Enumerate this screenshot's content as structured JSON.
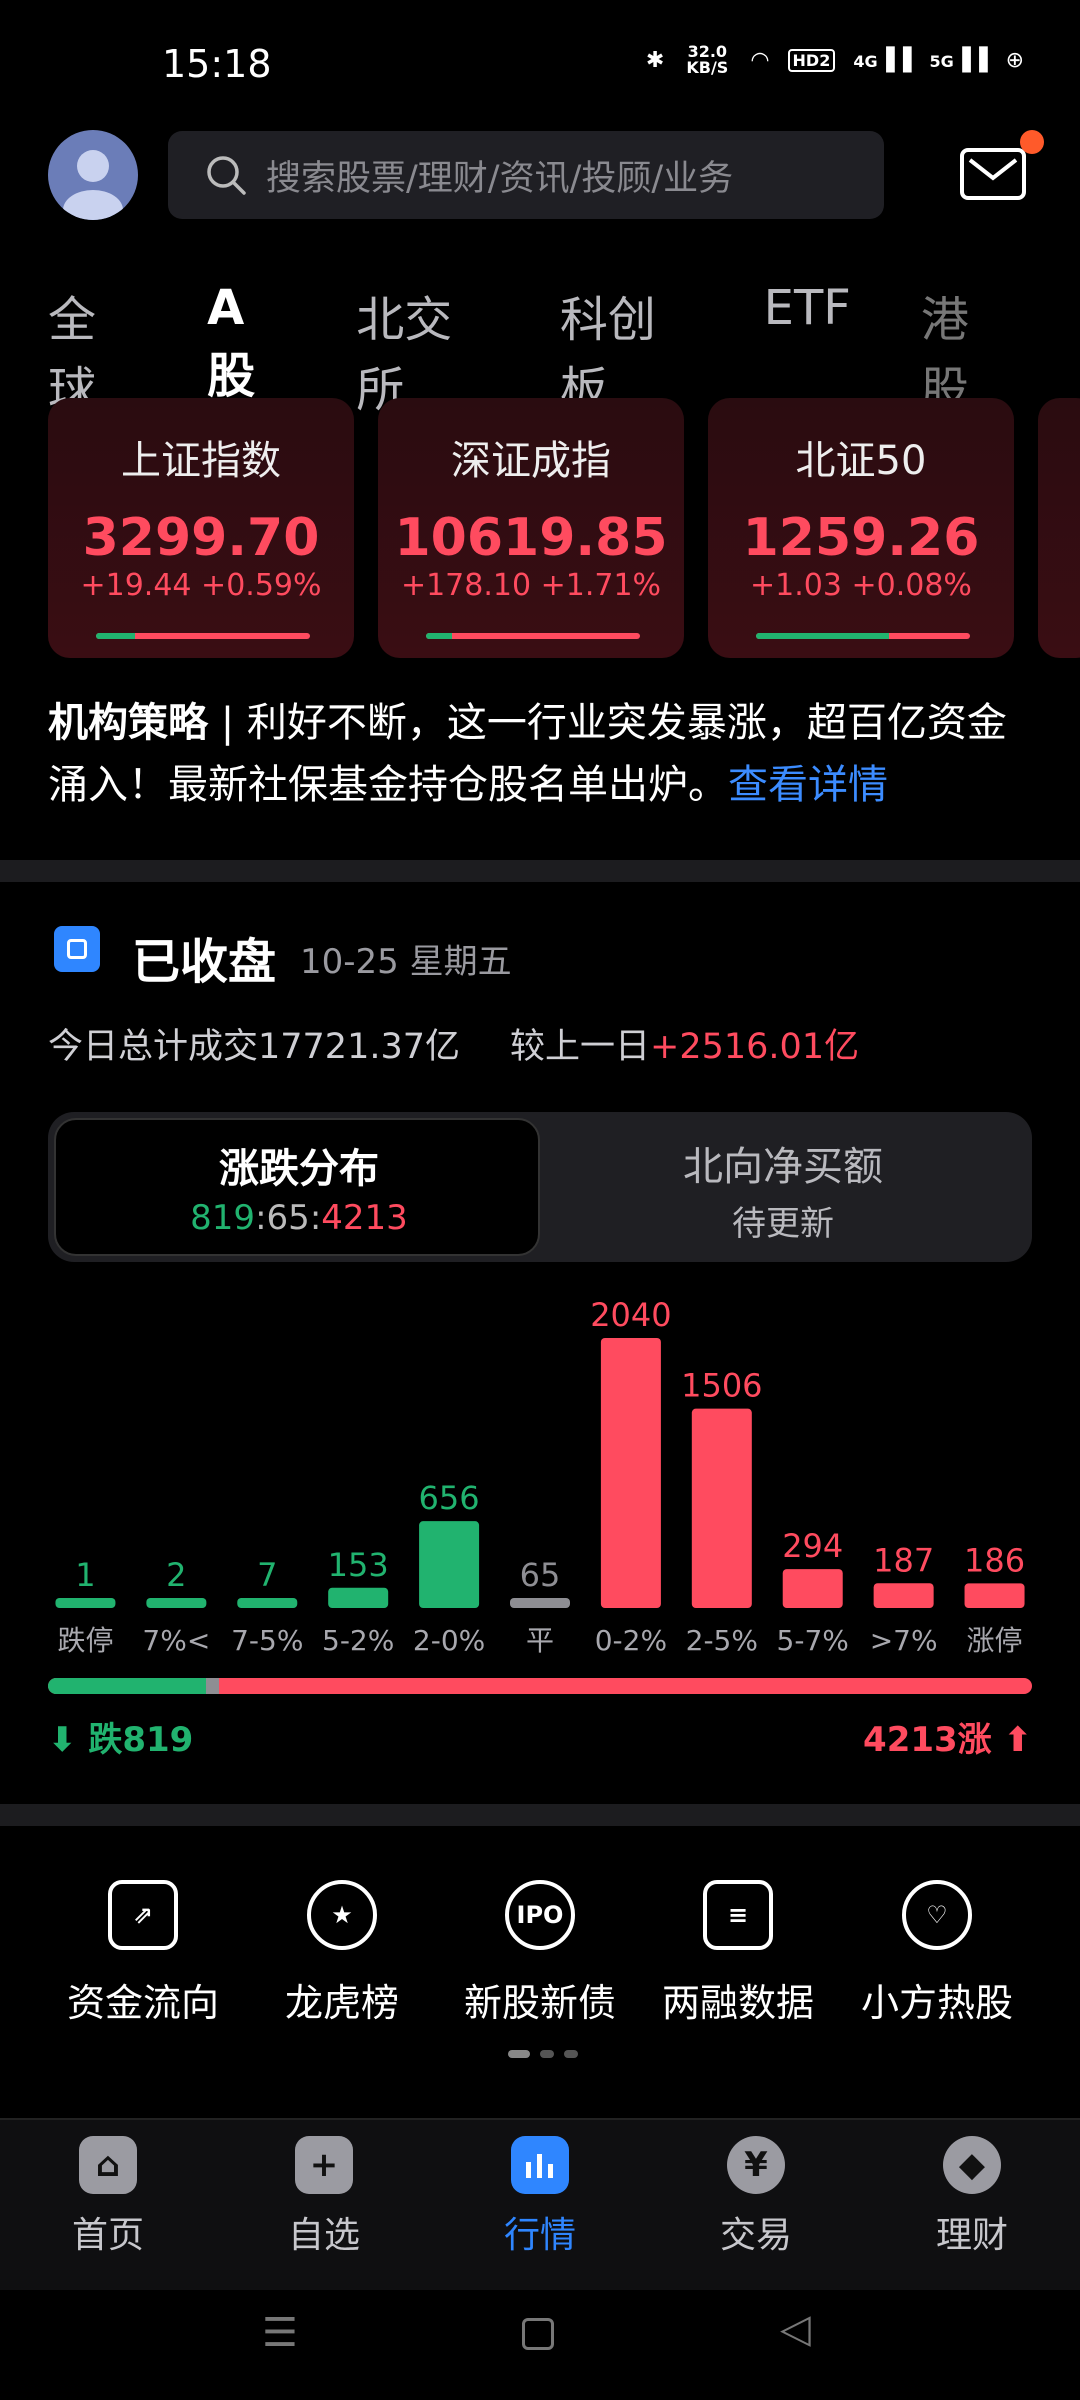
{
  "status": {
    "time": "15:18",
    "net_speed": "32.0 KB/S",
    "hd": "HD2",
    "sig1": "4G",
    "sig2": "5G"
  },
  "search": {
    "placeholder": "搜索股票/理财/资讯/投顾/业务"
  },
  "tabs": [
    "全球",
    "A股",
    "北交所",
    "科创板",
    "ETF",
    "港股"
  ],
  "active_tab": "A股",
  "indices": [
    {
      "name": "上证指数",
      "value": "3299.70",
      "change": "+19.44 +0.59%",
      "up_share": 0.18
    },
    {
      "name": "深证成指",
      "value": "10619.85",
      "change": "+178.10 +1.71%",
      "up_share": 0.12
    },
    {
      "name": "北证50",
      "value": "1259.26",
      "change": "+1.03 +0.08%",
      "up_share": 0.62
    }
  ],
  "news": {
    "tag": "机构策略",
    "text": " | 利好不断，这一行业突发暴涨，超百亿资金涌入！最新社保基金持仓股名单出炉。",
    "link": "查看详情"
  },
  "market": {
    "status": "已收盘",
    "date": "10-25 星期五",
    "turnover_label": "今日总计成交17721.37亿",
    "compare_label": "较上一日",
    "compare_value": "+2516.01亿"
  },
  "switcher": {
    "tab1_title": "涨跌分布",
    "tab1_fall": "819",
    "tab1_flat": "65",
    "tab1_rise": "4213",
    "tab2_title": "北向净买额",
    "tab2_sub": "待更新"
  },
  "chart_data": {
    "type": "bar",
    "categories": [
      "跌停",
      "7%<",
      "7-5%",
      "5-2%",
      "2-0%",
      "平",
      "0-2%",
      "2-5%",
      "5-7%",
      ">7%",
      "涨停"
    ],
    "values": [
      1,
      2,
      7,
      153,
      656,
      65,
      2040,
      1506,
      294,
      187,
      186
    ],
    "colors": [
      "#21b36f",
      "#21b36f",
      "#21b36f",
      "#21b36f",
      "#21b36f",
      "#8e8e93",
      "#ff4b5f",
      "#ff4b5f",
      "#ff4b5f",
      "#ff4b5f",
      "#ff4b5f"
    ],
    "ylim": [
      0,
      2040
    ]
  },
  "rise_fall": {
    "fall_label": "跌819",
    "rise_label": "4213涨",
    "fall": 819,
    "flat": 65,
    "rise": 4213
  },
  "quick_entries": [
    {
      "label": "资金流向",
      "icon": "fund-flow-icon"
    },
    {
      "label": "龙虎榜",
      "icon": "dragon-tiger-icon"
    },
    {
      "label": "新股新债",
      "icon": "ipo-icon",
      "icon_text": "IPO"
    },
    {
      "label": "两融数据",
      "icon": "margin-data-icon"
    },
    {
      "label": "小方热股",
      "icon": "hot-stock-icon"
    }
  ],
  "nav": [
    {
      "label": "首页",
      "icon": "home-icon"
    },
    {
      "label": "自选",
      "icon": "watchlist-icon",
      "glyph": "+"
    },
    {
      "label": "行情",
      "icon": "market-icon"
    },
    {
      "label": "交易",
      "icon": "trade-icon",
      "glyph": "¥"
    },
    {
      "label": "理财",
      "icon": "wealth-icon"
    }
  ],
  "active_nav": "行情"
}
